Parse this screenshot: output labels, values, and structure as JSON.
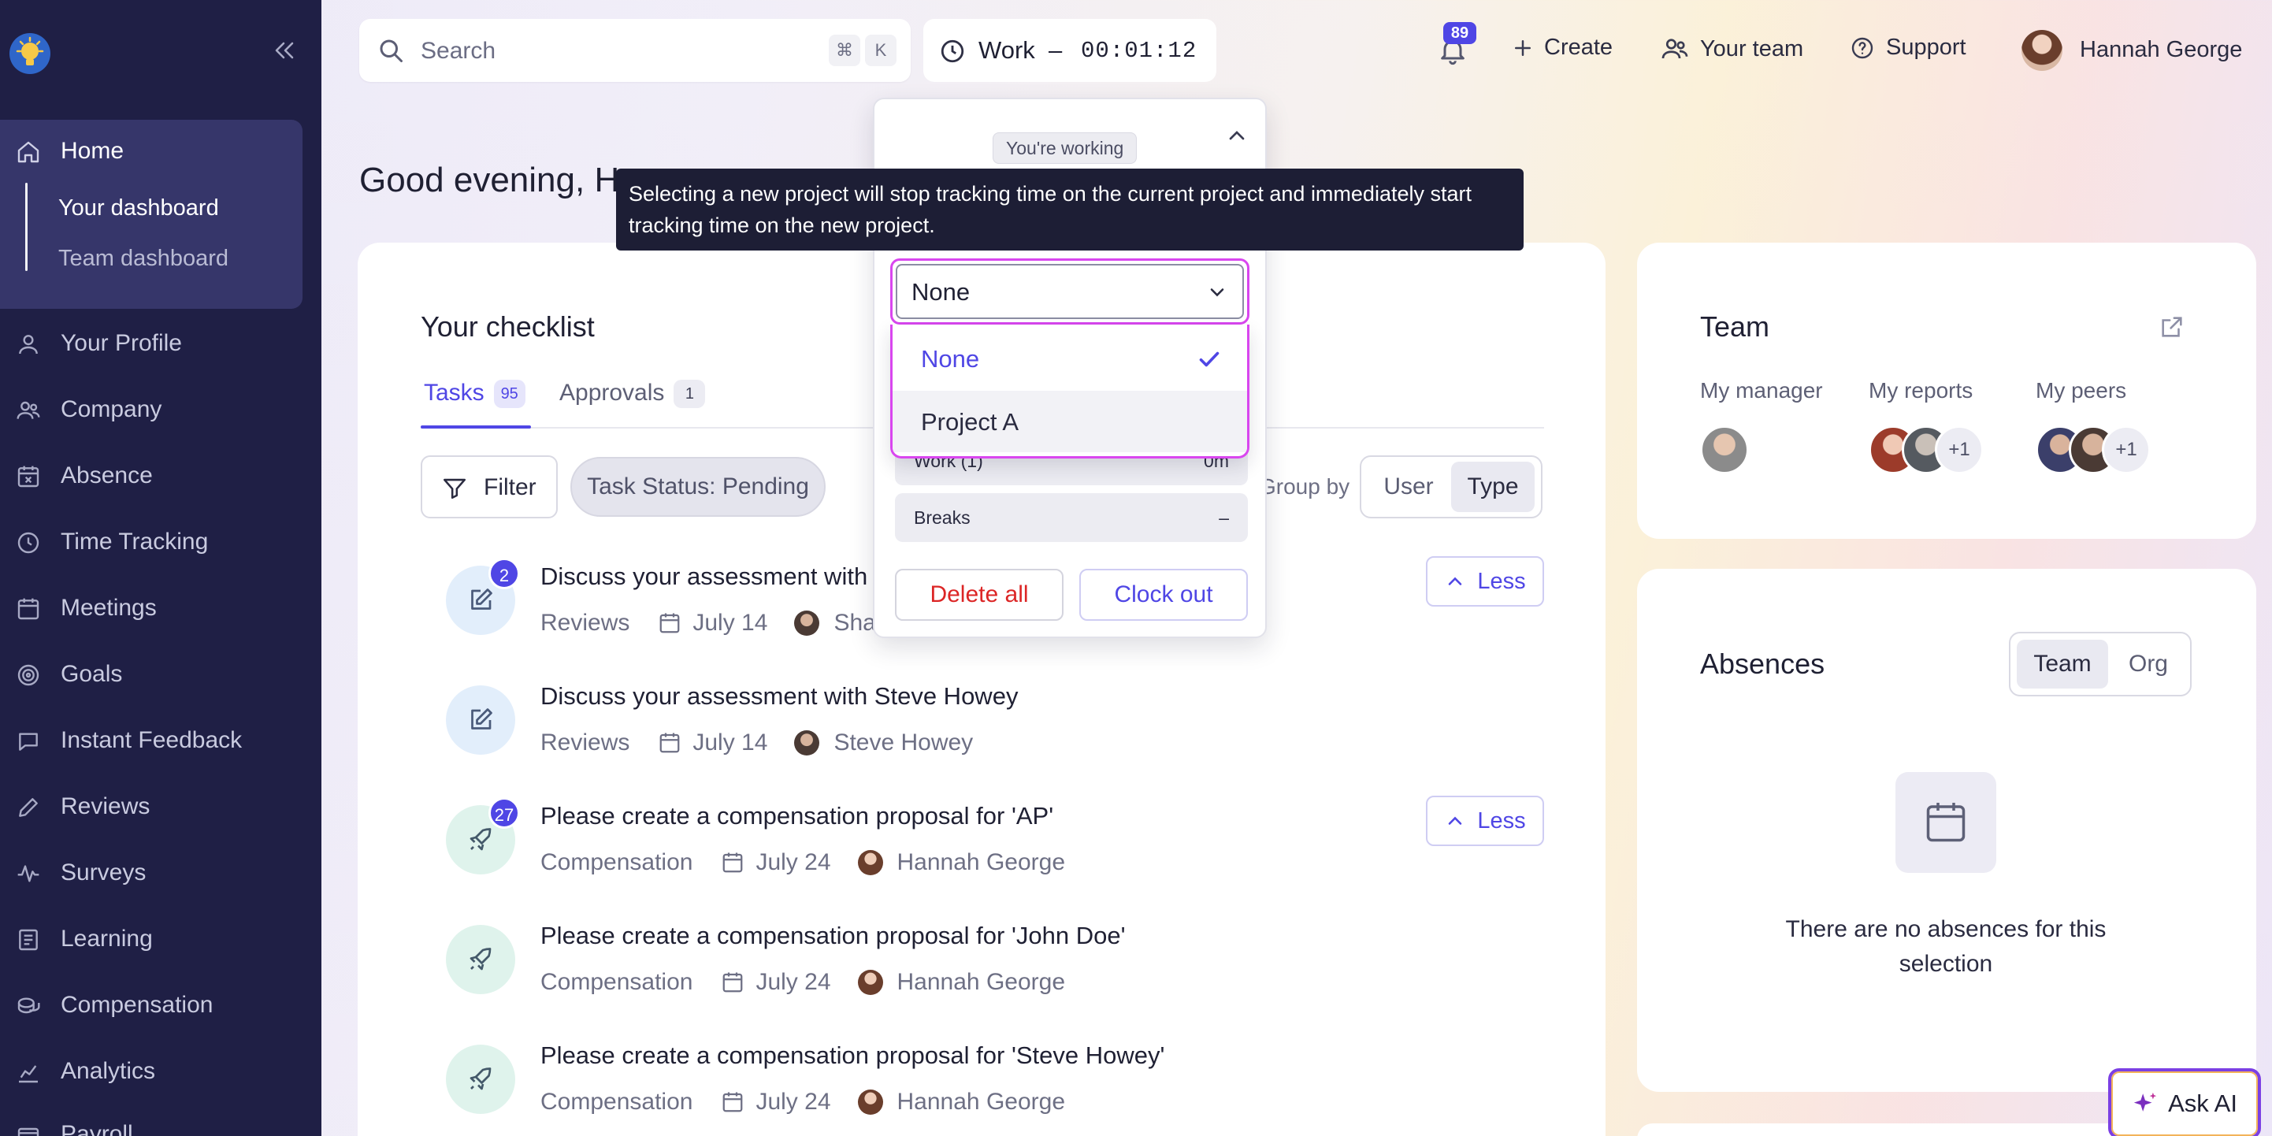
{
  "sidebar": {
    "collapse_label": "«",
    "items": [
      {
        "label": "Home",
        "icon": "home-icon"
      },
      {
        "label": "Your Profile",
        "icon": "user-icon"
      },
      {
        "label": "Company",
        "icon": "users-icon"
      },
      {
        "label": "Absence",
        "icon": "calendar-x-icon"
      },
      {
        "label": "Time Tracking",
        "icon": "clock-icon"
      },
      {
        "label": "Meetings",
        "icon": "calendar-icon"
      },
      {
        "label": "Goals",
        "icon": "target-icon"
      },
      {
        "label": "Instant Feedback",
        "icon": "chat-icon"
      },
      {
        "label": "Reviews",
        "icon": "pencil-icon"
      },
      {
        "label": "Surveys",
        "icon": "pulse-icon"
      },
      {
        "label": "Learning",
        "icon": "book-icon"
      },
      {
        "label": "Compensation",
        "icon": "coins-icon"
      },
      {
        "label": "Analytics",
        "icon": "chart-icon"
      },
      {
        "label": "Payroll",
        "icon": "wallet-icon"
      }
    ],
    "home_sub": [
      "Your dashboard",
      "Team dashboard"
    ]
  },
  "topbar": {
    "search_placeholder": "Search",
    "kbd1": "⌘",
    "kbd2": "K",
    "timer_label": "Work  –",
    "timer_value": "00:01:12",
    "notifications": "89",
    "create": "Create",
    "your_team": "Your team",
    "support": "Support",
    "user_name": "Hannah George"
  },
  "greeting": "Good evening, H",
  "checklist": {
    "title": "Your checklist",
    "tabs": [
      {
        "label": "Tasks",
        "count": "95"
      },
      {
        "label": "Approvals",
        "count": "1"
      }
    ],
    "filter": "Filter",
    "status_chip": "Task Status: Pending",
    "group_by": "Group by",
    "group_options": [
      "User",
      "Type"
    ],
    "less": "Less",
    "tasks": [
      {
        "title": "Discuss your assessment with Sh",
        "category": "Reviews",
        "date": "July 14",
        "person": "Shan",
        "badge": "2"
      },
      {
        "title": "Discuss your assessment with Steve Howey",
        "category": "Reviews",
        "date": "July 14",
        "person": "Steve Howey",
        "badge": ""
      },
      {
        "title": "Please create a compensation proposal for 'AP'",
        "category": "Compensation",
        "date": "July 24",
        "person": "Hannah George",
        "badge": "27"
      },
      {
        "title": "Please create a compensation proposal for 'John Doe'",
        "category": "Compensation",
        "date": "July 24",
        "person": "Hannah George",
        "badge": ""
      },
      {
        "title": "Please create a compensation proposal for 'Steve Howey'",
        "category": "Compensation",
        "date": "July 24",
        "person": "Hannah George",
        "badge": ""
      }
    ]
  },
  "team_card": {
    "title": "Team",
    "my_manager": "My manager",
    "my_reports": "My reports",
    "my_peers": "My peers",
    "reports_more": "+1",
    "peers_more": "+1"
  },
  "absences": {
    "title": "Absences",
    "options": [
      "Team",
      "Org"
    ],
    "empty": "There are no absences for this selection"
  },
  "popover": {
    "status": "You're working",
    "selected_project": "None",
    "options": [
      "None",
      "Project A"
    ],
    "work_label": "Work (1)",
    "work_value": "0m",
    "breaks_label": "Breaks",
    "breaks_value": "–",
    "delete_all": "Delete all",
    "clock_out": "Clock out"
  },
  "tooltip": "Selecting a new project will stop tracking time on the current project and immediately start tracking time on the new project.",
  "ask_ai": "Ask AI",
  "colors": {
    "accent": "#4f46e5",
    "sidebar": "#1f1f45",
    "danger": "#dc2626",
    "focus_ring": "#d946ef"
  }
}
